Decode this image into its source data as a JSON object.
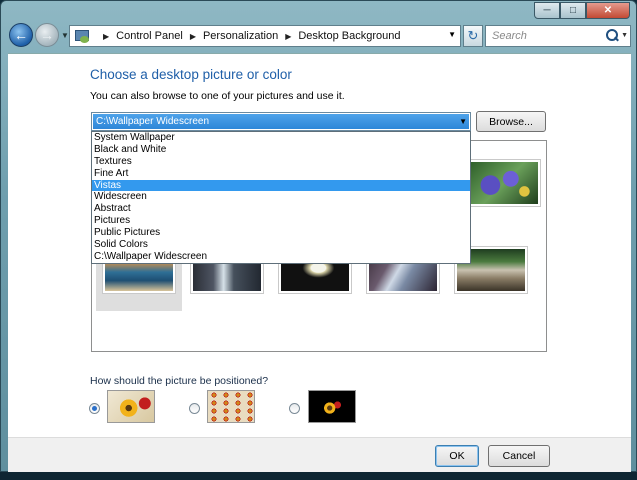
{
  "window": {
    "caption_buttons": {
      "minimize": "─",
      "maximize": "□",
      "close": "✕"
    }
  },
  "nav": {
    "breadcrumbs": [
      "Control Panel",
      "Personalization",
      "Desktop Background"
    ],
    "search_placeholder": "Search",
    "icons": [
      "back-arrow-icon",
      "forward-arrow-icon",
      "control-panel-icon",
      "refresh-icon",
      "search-icon"
    ]
  },
  "main": {
    "heading": "Choose a desktop picture or color",
    "subtext": "You can also browse to one of your pictures and use it.",
    "location_combo": {
      "value": "C:\\Wallpaper Widescreen"
    },
    "browse_label": "Browse...",
    "dropdown_options": [
      "System Wallpaper",
      "Black and White",
      "Textures",
      "Fine Art",
      "Vistas",
      "Widescreen",
      "Abstract",
      "Pictures",
      "Public Pictures",
      "Solid Colors",
      "C:\\Wallpaper Widescreen"
    ],
    "highlighted_option": "Vistas",
    "position_question": "How should the picture be positioned?",
    "position_options": [
      "fit-to-screen",
      "tile",
      "center"
    ],
    "selected_position": "fit-to-screen"
  },
  "buttons": {
    "ok": "OK",
    "cancel": "Cancel"
  },
  "colors": {
    "accent": "#1f5fa8",
    "selection": "#3399ee",
    "window_frame": "#6f9fae"
  }
}
